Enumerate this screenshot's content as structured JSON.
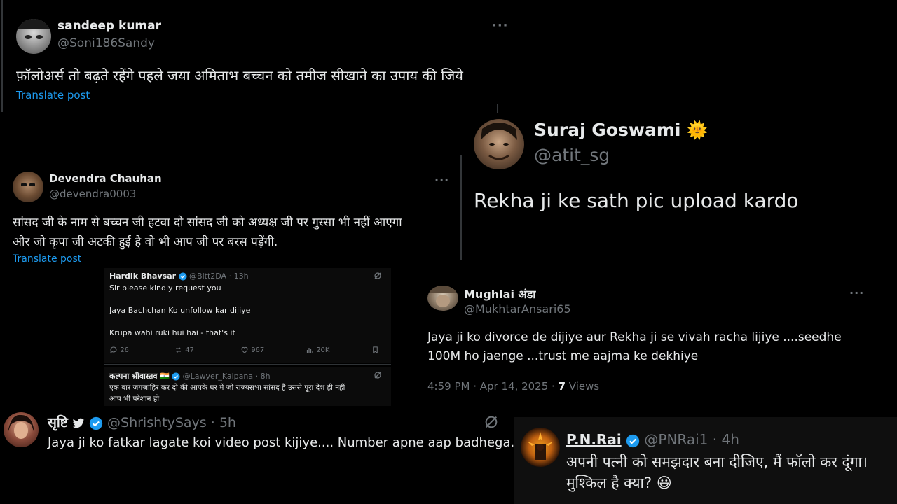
{
  "post1": {
    "name": "sandeep kumar",
    "handle": "@Soni186Sandy",
    "text": "फ़ॉलोअर्स तो बढ़ते रहेंगे पहले जया अमिताभ बच्चन को तमीज सीखाने का उपाय की जिये",
    "translate": "Translate post",
    "more": "···"
  },
  "post2": {
    "name": "Devendra Chauhan",
    "handle": "@devendra0003",
    "text_line1": "सांसद जी के नाम से बच्चन जी हटवा दो सांसद जी को अध्यक्ष जी पर गुस्सा भी नहीं आएगा",
    "text_line2": "और जो कृपा जी अटकी हुई है वो भी आप जी पर बरस पड़ेंगी.",
    "translate": "Translate post",
    "more": "···"
  },
  "post3": {
    "name": "Suraj Goswami",
    "handle": "@atit_sg",
    "text": "Rekha ji ke sath pic upload kardo",
    "emoji": "🌞"
  },
  "post4": {
    "name": "Hardik Bhavsar",
    "handle": "@Bitt2DA",
    "time": "· 13h",
    "line1": "Sir please kindly request you",
    "line2": "Jaya Bachchan Ko unfollow kar dijiye",
    "line3": "Krupa wahi ruki hui hai - that's it",
    "replies": "26",
    "reposts": "47",
    "likes": "967",
    "views": "20K"
  },
  "post5": {
    "name": "कल्पना श्रीवास्तव",
    "flag": "🇮🇳",
    "handle": "@Lawyer_Kalpana",
    "time": "· 8h",
    "line1": "एक बार जगजाहिर कर दो की आपके घर में जो राज्यसभा सांसद हैं उससे पूरा देश ही नहीं",
    "line2": "आप भी परेशान हो"
  },
  "post6": {
    "name": "Mughlai अंडा",
    "handle": "@MukhtarAnsari65",
    "line1": "Jaya ji ko divorce de dijiye aur Rekha ji se vivah racha lijiye ....seedhe",
    "line2": "100M ho jaenge ...trust me aajma ke dekhiye",
    "timestamp": "4:59 PM · Apr 14, 2025 ·",
    "views_count": "7",
    "views_label": "Views",
    "more": "···"
  },
  "post7": {
    "name": "सृष्टि",
    "handle": "@ShrishtySays",
    "time": "· 5h",
    "text": "Jaya ji ko fatkar lagate koi video post kijiye.... Number apne aap badhega."
  },
  "post8": {
    "name": "P.N.Rai",
    "handle": "@PNRai1",
    "time": "· 4h",
    "line1": "अपनी पत्नी को समझदार बना दीजिए, मैं फॉलो कर दूंगा।",
    "line2": "मुश्किल है क्या?",
    "emoji": "😃"
  },
  "colors": {
    "background": "#000000",
    "text": "#e7e9ea",
    "secondary": "#71767b",
    "link": "#1d9bf0",
    "verified": "#1d9bf0"
  }
}
